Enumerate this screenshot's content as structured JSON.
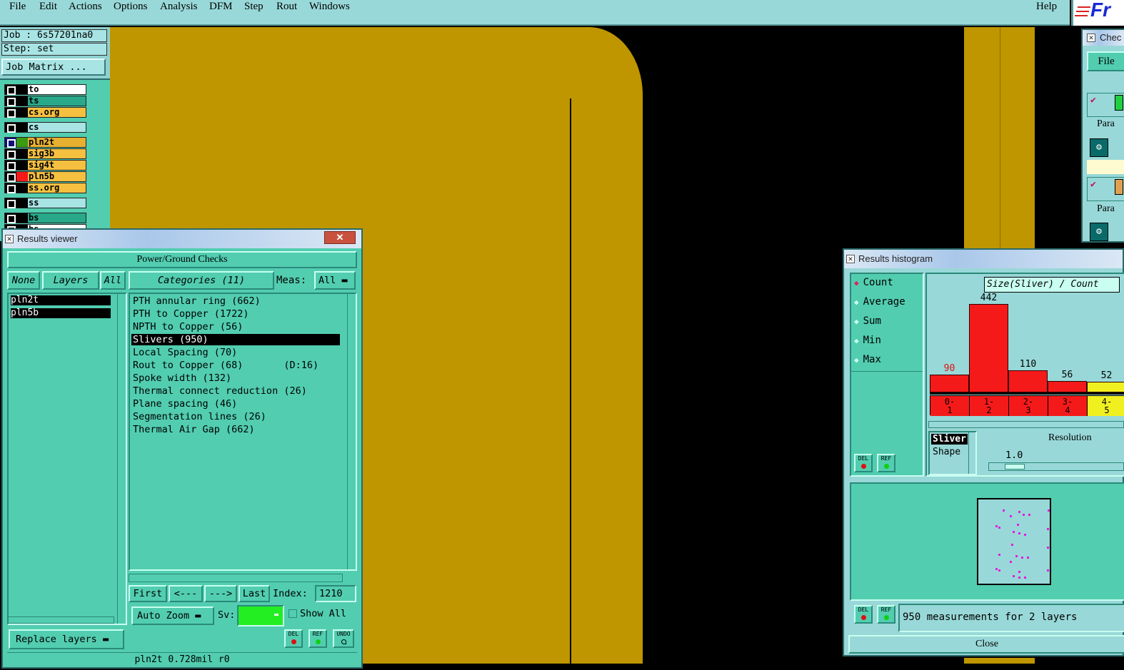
{
  "menu": {
    "items": [
      "File",
      "Edit",
      "Actions",
      "Options",
      "Analysis",
      "DFM",
      "Step",
      "Rout",
      "Windows"
    ],
    "help": "Help",
    "logo": "Fr"
  },
  "job": {
    "job_line": "Job : 6s57201na0",
    "step_line": "Step: set",
    "matrix_button": "Job Matrix ..."
  },
  "layers": [
    {
      "name": "to",
      "color": "#ffffff"
    },
    {
      "name": "ts",
      "color": "#29a88a"
    },
    {
      "name": "cs.org",
      "color": "#f5c040"
    },
    {
      "name": "cs",
      "color": "#a8e4e4"
    },
    {
      "name": "pln2t",
      "color": "#e8b030"
    },
    {
      "name": "sig3b",
      "color": "#f5c040"
    },
    {
      "name": "sig4t",
      "color": "#f5c040"
    },
    {
      "name": "pln5b",
      "color": "#f5c040"
    },
    {
      "name": "ss.org",
      "color": "#f5c040"
    },
    {
      "name": "ss",
      "color": "#a8e4e4"
    },
    {
      "name": "bs",
      "color": "#29a88a"
    },
    {
      "name": "bs",
      "color": "#ffffff"
    }
  ],
  "results_viewer": {
    "title": "Results viewer",
    "close": "✕",
    "header": "Power/Ground Checks",
    "none_btn": "None",
    "layers_btn": "Layers",
    "all_btn": "All",
    "layer_list": [
      "pln2t",
      "pln5b"
    ],
    "categories_btn": "Categories (11)",
    "meas_label": "Meas:",
    "meas_value": "All",
    "categories": [
      "PTH annular ring (662)",
      "PTH to Copper (1722)",
      "NPTH to Copper (56)",
      "Slivers (950)",
      "Local Spacing (70)",
      "Rout to Copper (68)       (D:16)",
      "Spoke width (132)",
      "Thermal connect reduction (26)",
      "Plane spacing (46)",
      "Segmentation lines (26)",
      "Thermal Air Gap (662)"
    ],
    "selected_category": 3,
    "first_btn": "First",
    "prev_btn": "<---",
    "next_btn": "--->",
    "last_btn": "Last",
    "index_label": "Index:",
    "index_value": "1210",
    "auto_zoom": "Auto Zoom",
    "sv_label": "Sv:",
    "show_all": "Show All",
    "replace_layers": "Replace layers",
    "del": "DEL",
    "ref": "REF",
    "undo": "UNDO",
    "status": "pln2t 0.728mil  r0"
  },
  "histogram": {
    "title": "Results histogram",
    "modes": [
      "Count",
      "Average",
      "Sum",
      "Min",
      "Max"
    ],
    "selected_mode": "Count",
    "chart_label": "Size(Sliver) / Count",
    "bars": [
      {
        "bucket_top": "0-",
        "bucket_bottom": "1",
        "value": 90,
        "color": "#f41a1a"
      },
      {
        "bucket_top": "1-",
        "bucket_bottom": "2",
        "value": 442,
        "color": "#f41a1a"
      },
      {
        "bucket_top": "2-",
        "bucket_bottom": "3",
        "value": 110,
        "color": "#f41a1a"
      },
      {
        "bucket_top": "3-",
        "bucket_bottom": "4",
        "value": 56,
        "color": "#f41a1a"
      },
      {
        "bucket_top": "4-",
        "bucket_bottom": "5",
        "value": 52,
        "color": "#f0f020"
      }
    ],
    "attr_list": [
      "Sliver",
      "Shape"
    ],
    "resolution_label": "Resolution",
    "resolution_value": "1.0",
    "del": "DEL",
    "ref": "REF",
    "measurements": "950 measurements for 2 layers",
    "close": "Close"
  },
  "check_panel": {
    "title": "Chec",
    "file": "File",
    "para1": "Para",
    "para2": "Para"
  },
  "colors": {
    "copper": "#bf9600",
    "panel_bg": "#52cdb0",
    "menu_bg": "#99d8d8"
  }
}
